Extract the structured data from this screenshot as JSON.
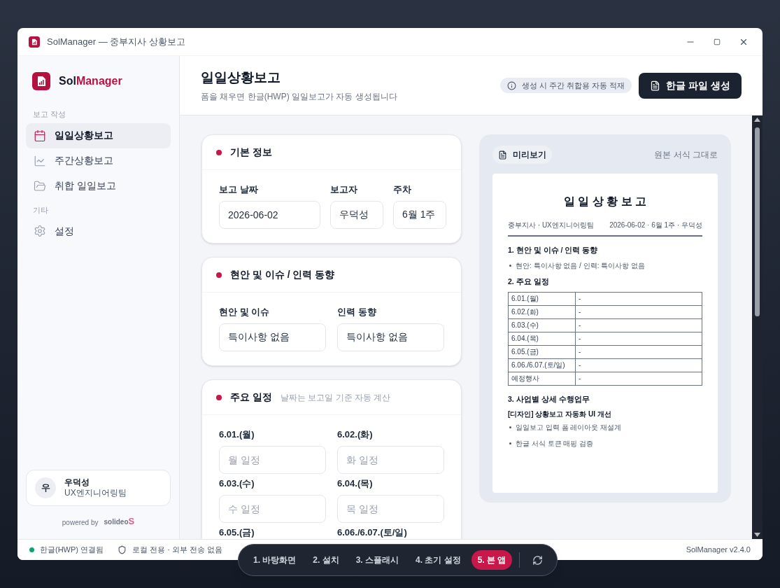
{
  "window": {
    "title": "SolManager — 중부지사 상황보고"
  },
  "sidebar": {
    "brand_prefix": "Sol",
    "brand_suffix": "Manager",
    "sections": [
      {
        "heading": "보고 작성",
        "items": [
          {
            "label": "일일상황보고",
            "selected": true
          },
          {
            "label": "주간상황보고",
            "selected": false
          },
          {
            "label": "취합 일일보고",
            "selected": false
          }
        ]
      },
      {
        "heading": "기타",
        "items": [
          {
            "label": "설정",
            "selected": false
          }
        ]
      }
    ],
    "user": {
      "avatar": "우",
      "name": "우덕성",
      "team": "UX엔지니어링팀"
    },
    "powered_by": "powered by",
    "partner_logo": "solideo",
    "partner_mark": "S"
  },
  "header": {
    "title": "일일상황보고",
    "subtitle": "폼을 채우면 한글(HWP) 일일보고가 자동 생성됩니다",
    "info_badge": "생성 시 주간 취합용 자동 적재",
    "generate_button": "한글 파일 생성"
  },
  "cards": [
    {
      "title": "기본 정보",
      "kind": "row",
      "fields": [
        {
          "label": "보고 날짜",
          "value": "2026-06-02"
        },
        {
          "label": "보고자",
          "value": "우덕성"
        },
        {
          "label": "주차",
          "value": "6월 1주"
        }
      ]
    },
    {
      "title": "현안 및 이슈 / 인력 동향",
      "kind": "grid",
      "fields": [
        {
          "label": "현안 및 이슈",
          "value": "특이사항 없음"
        },
        {
          "label": "인력 동향",
          "value": "특이사항 없음"
        }
      ]
    },
    {
      "title": "주요 일정",
      "hint": "날짜는 보고일 기준 자동 계산",
      "kind": "grid",
      "fields": [
        {
          "label": "6.01.(월)",
          "placeholder": "월 일정"
        },
        {
          "label": "6.02.(화)",
          "placeholder": "화 일정"
        },
        {
          "label": "6.03.(수)",
          "placeholder": "수 일정"
        },
        {
          "label": "6.04.(목)",
          "placeholder": "목 일정"
        },
        {
          "label": "6.05.(금)"
        },
        {
          "label": "6.06./6.07.(토/일)"
        }
      ]
    }
  ],
  "preview": {
    "badge": "미리보기",
    "note": "원본 서식 그대로",
    "doc_title": "일 일 상 황 보 고",
    "meta_left": "중부지사 · UX엔지니어링팀",
    "meta_right": "2026-06-02 · 6월 1주 · 우덕성",
    "blocks": [
      {
        "kind": "heading",
        "text": "1. 현안 및 이슈 / 인력 동향"
      },
      {
        "kind": "bullet",
        "text": "현안: 특이사항 없음 / 인력: 특이사항 없음"
      },
      {
        "kind": "heading",
        "text": "2. 주요 일정"
      },
      {
        "kind": "table",
        "rows": [
          [
            "6.01.(월)",
            "-"
          ],
          [
            "6.02.(화)",
            "-"
          ],
          [
            "6.03.(수)",
            "-"
          ],
          [
            "6.04.(목)",
            "-"
          ],
          [
            "6.05.(금)",
            "-"
          ],
          [
            "6.06./6.07.(토/일)",
            "-"
          ],
          [
            "예정행사",
            "-"
          ]
        ]
      },
      {
        "kind": "heading",
        "text": "3. 사업별 상세 수행업무"
      },
      {
        "kind": "subheading",
        "text": "[디자인] 상황보고 자동화 UI 개선"
      },
      {
        "kind": "bullet",
        "text": "일일보고 입력 폼 레이아웃 재설계"
      },
      {
        "kind": "bullet",
        "text": "한글 서식 토큰 매핑 검증"
      }
    ]
  },
  "status_bar": {
    "connection": {
      "label": "한글(HWP) 연결됨",
      "connected": true
    },
    "privacy": "로컬 전용 · 외부 전송 없음",
    "version": "SolManager v2.4.0"
  },
  "step_nav": {
    "steps": [
      {
        "label": "1. 바탕화면",
        "selected": false
      },
      {
        "label": "2. 설치",
        "selected": false
      },
      {
        "label": "3. 스플래시",
        "selected": false
      },
      {
        "label": "4. 초기 설정",
        "selected": false
      },
      {
        "label": "5. 본 앱",
        "selected": true
      }
    ]
  }
}
